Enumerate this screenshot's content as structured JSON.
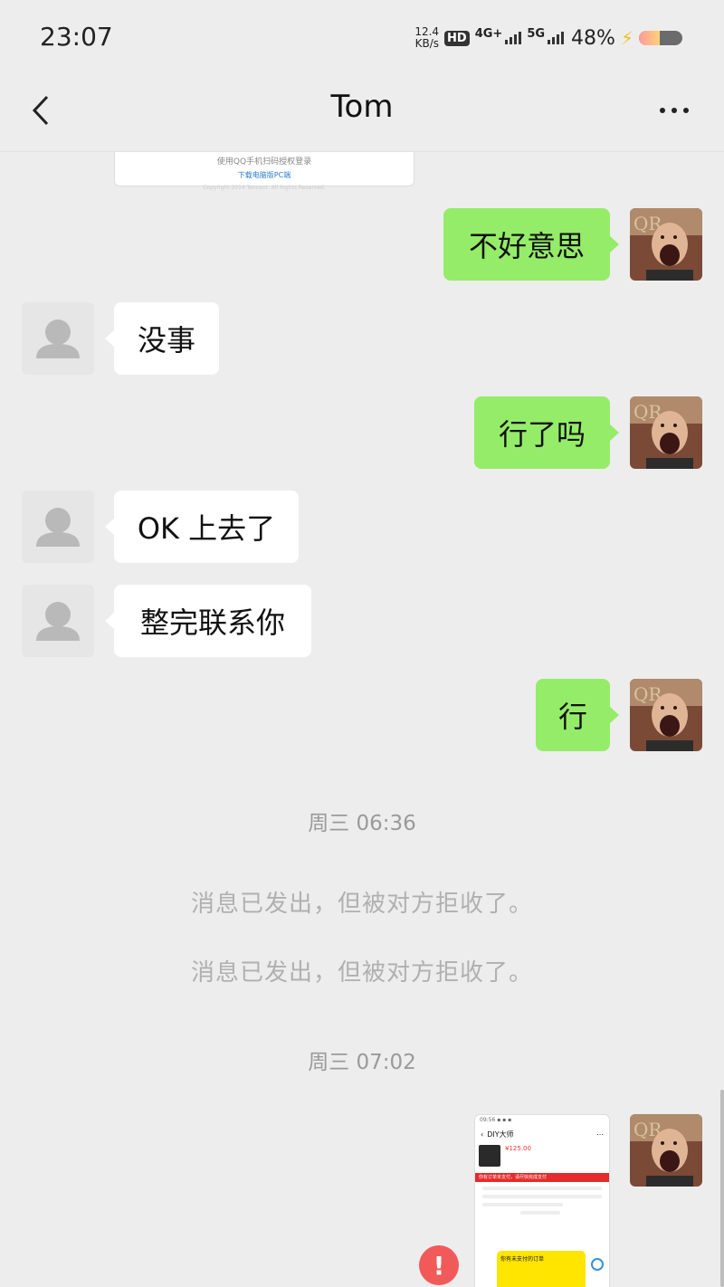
{
  "status_bar": {
    "time": "23:07",
    "net_speed_top": "12.4",
    "net_speed_bottom": "KB/s",
    "hd": "HD",
    "network_1": "4G+",
    "network_2": "5G",
    "battery": "48%",
    "battery_level": 0.48
  },
  "nav": {
    "title": "Tom"
  },
  "top_card": {
    "line1": "使用QQ手机扫码授权登录",
    "line2": "下载电脑版PC端",
    "line3": "Copyright 2014 Tencent. All Rights Reserved."
  },
  "messages": [
    {
      "side": "right",
      "text": "不好意思"
    },
    {
      "side": "left",
      "text": "没事"
    },
    {
      "side": "right",
      "text": "行了吗"
    },
    {
      "side": "left",
      "text": "OK 上去了"
    },
    {
      "side": "left",
      "text": "整完联系你"
    },
    {
      "side": "right",
      "text": "行"
    }
  ],
  "timestamps": [
    "周三 06:36",
    "周三 07:02"
  ],
  "system_messages": [
    "消息已发出，但被对方拒收了。",
    "消息已发出，但被对方拒收了。"
  ],
  "screenshot": {
    "app_title": "DIY大师",
    "price": "¥125.00",
    "red_bar": "你有订单未支付，请尽快完成支付",
    "yellow_box": "你有未支付的订单"
  },
  "error_icon": "!"
}
